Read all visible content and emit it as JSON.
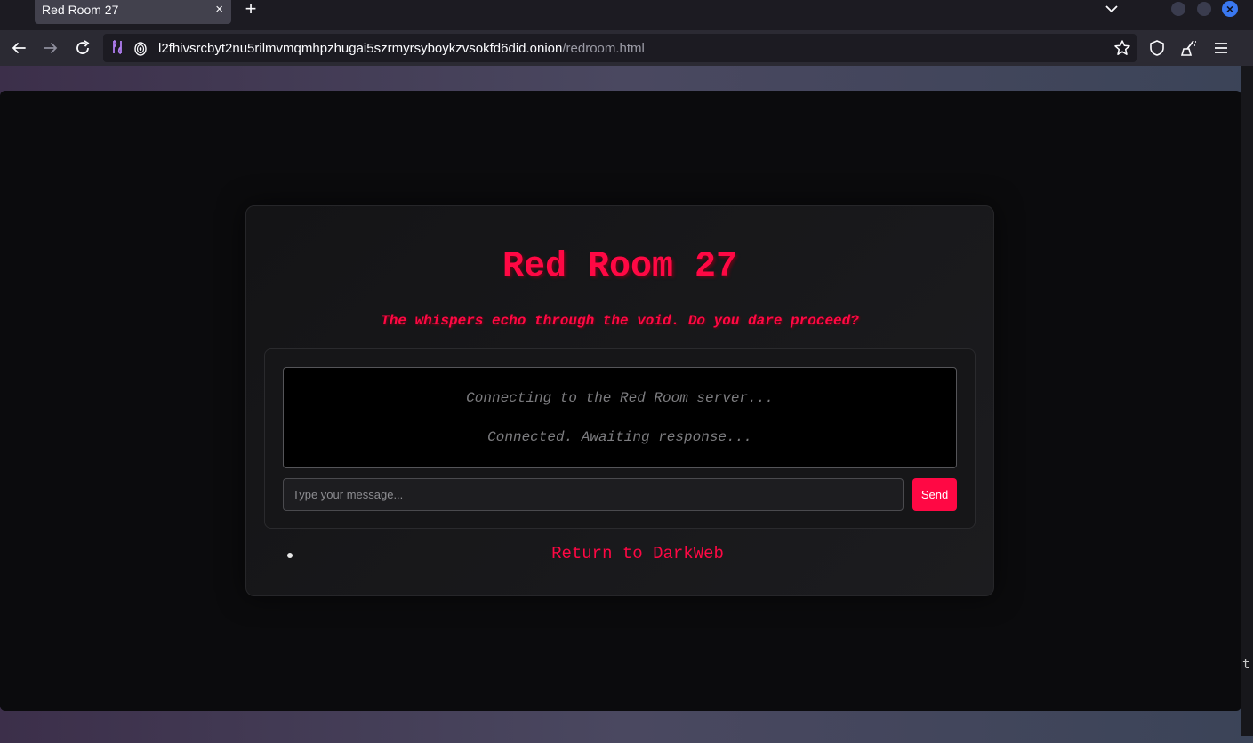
{
  "browser": {
    "tab_title": "Red Room 27",
    "tab_close": "×",
    "new_tab": "+",
    "url_host": "l2fhivsrcbyt2nu5rilmvmqmhpzhugai5szrmyrsyboykzvsokfd6did.onion",
    "url_path": "/redroom.html",
    "window_close": "×",
    "accent_color": "#3a78f0"
  },
  "page": {
    "title": "Red Room 27",
    "subtitle": "The whispers echo through the void. Do you dare proceed?",
    "chat_log": [
      "Connecting to the Red Room server...",
      "Connected. Awaiting response..."
    ],
    "input_placeholder": "Type your message...",
    "send_label": "Send",
    "return_link": "Return to DarkWeb",
    "accent_color": "#ff0844"
  },
  "overflow_text": "t"
}
